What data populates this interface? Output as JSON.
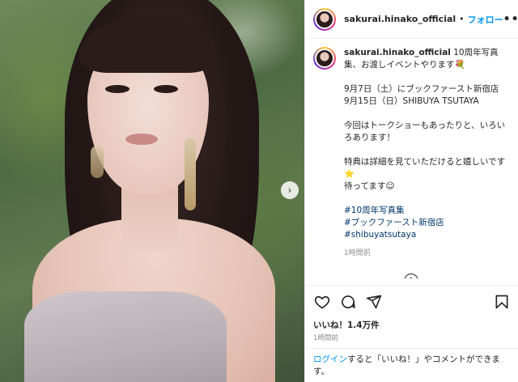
{
  "post": {
    "username": "sakurai.hinako_official",
    "dot": "•",
    "follow_label": "フォロー",
    "more_icon": "•••",
    "caption_lines": [
      "10周年写真集、お渡しイベントやります💐",
      "",
      "9月7日（土）にブックファースト新宿店",
      "9月15日（日）SHIBUYA TSUTAYA",
      "",
      "今回はトークショーもあったりと、いろいろあります！",
      "",
      "特典は詳細を見ていただけると嬉しいです⭐",
      "待ってます☺"
    ],
    "hashtags": [
      "#10周年写真集",
      "#ブックファースト新宿店",
      "#shibuyatsutaya"
    ],
    "caption_time": "1時間前",
    "likes": "いいね！1.4万件",
    "post_time": "1時間前",
    "login_link": "ログイン",
    "login_text": "すると「いいね！」やコメントができます。",
    "carousel_next_icon": "›",
    "add_comment_icon": "+"
  },
  "colors": {
    "link_blue": "#0095f6",
    "hashtag_blue": "#00376b",
    "muted": "#8e8e8e",
    "text": "#262626"
  },
  "icons": [
    "heart-icon",
    "comment-icon",
    "share-icon",
    "bookmark-icon",
    "more-icon",
    "plus-circle-icon",
    "chevron-right-icon"
  ]
}
